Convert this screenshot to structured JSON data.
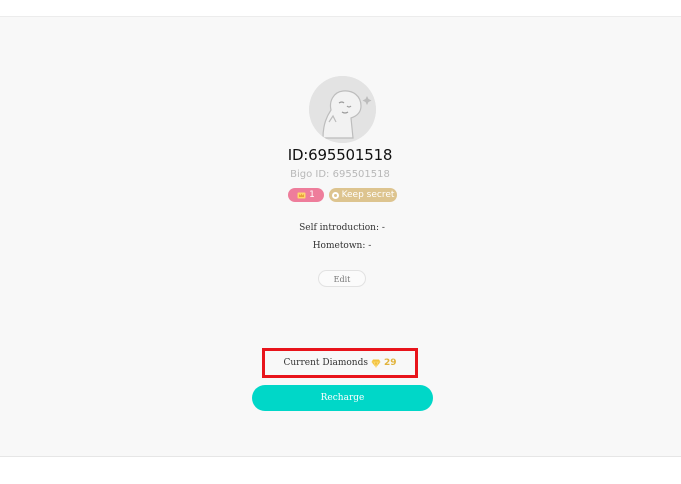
{
  "profile": {
    "user_id": "ID:695501518",
    "bigo_id": "Bigo ID: 695501518",
    "level_badge": "1",
    "privacy_badge": "Keep secret",
    "self_introduction": "Self introduction: -",
    "hometown": "Hometown: -",
    "edit_label": "Edit"
  },
  "wallet": {
    "diamonds_label": "Current Diamonds",
    "diamonds_count": "29",
    "recharge_label": "Recharge"
  },
  "icons": {
    "avatar": "default-avatar-icon",
    "level": "crown-icon",
    "privacy": "privacy-icon",
    "diamond": "diamond-icon"
  },
  "colors": {
    "accent": "#00d7c8",
    "level_badge": "#ee7d9b",
    "privacy_badge": "#ddc48f",
    "highlight_box": "#e8141b",
    "diamond": "#f3c23c"
  }
}
